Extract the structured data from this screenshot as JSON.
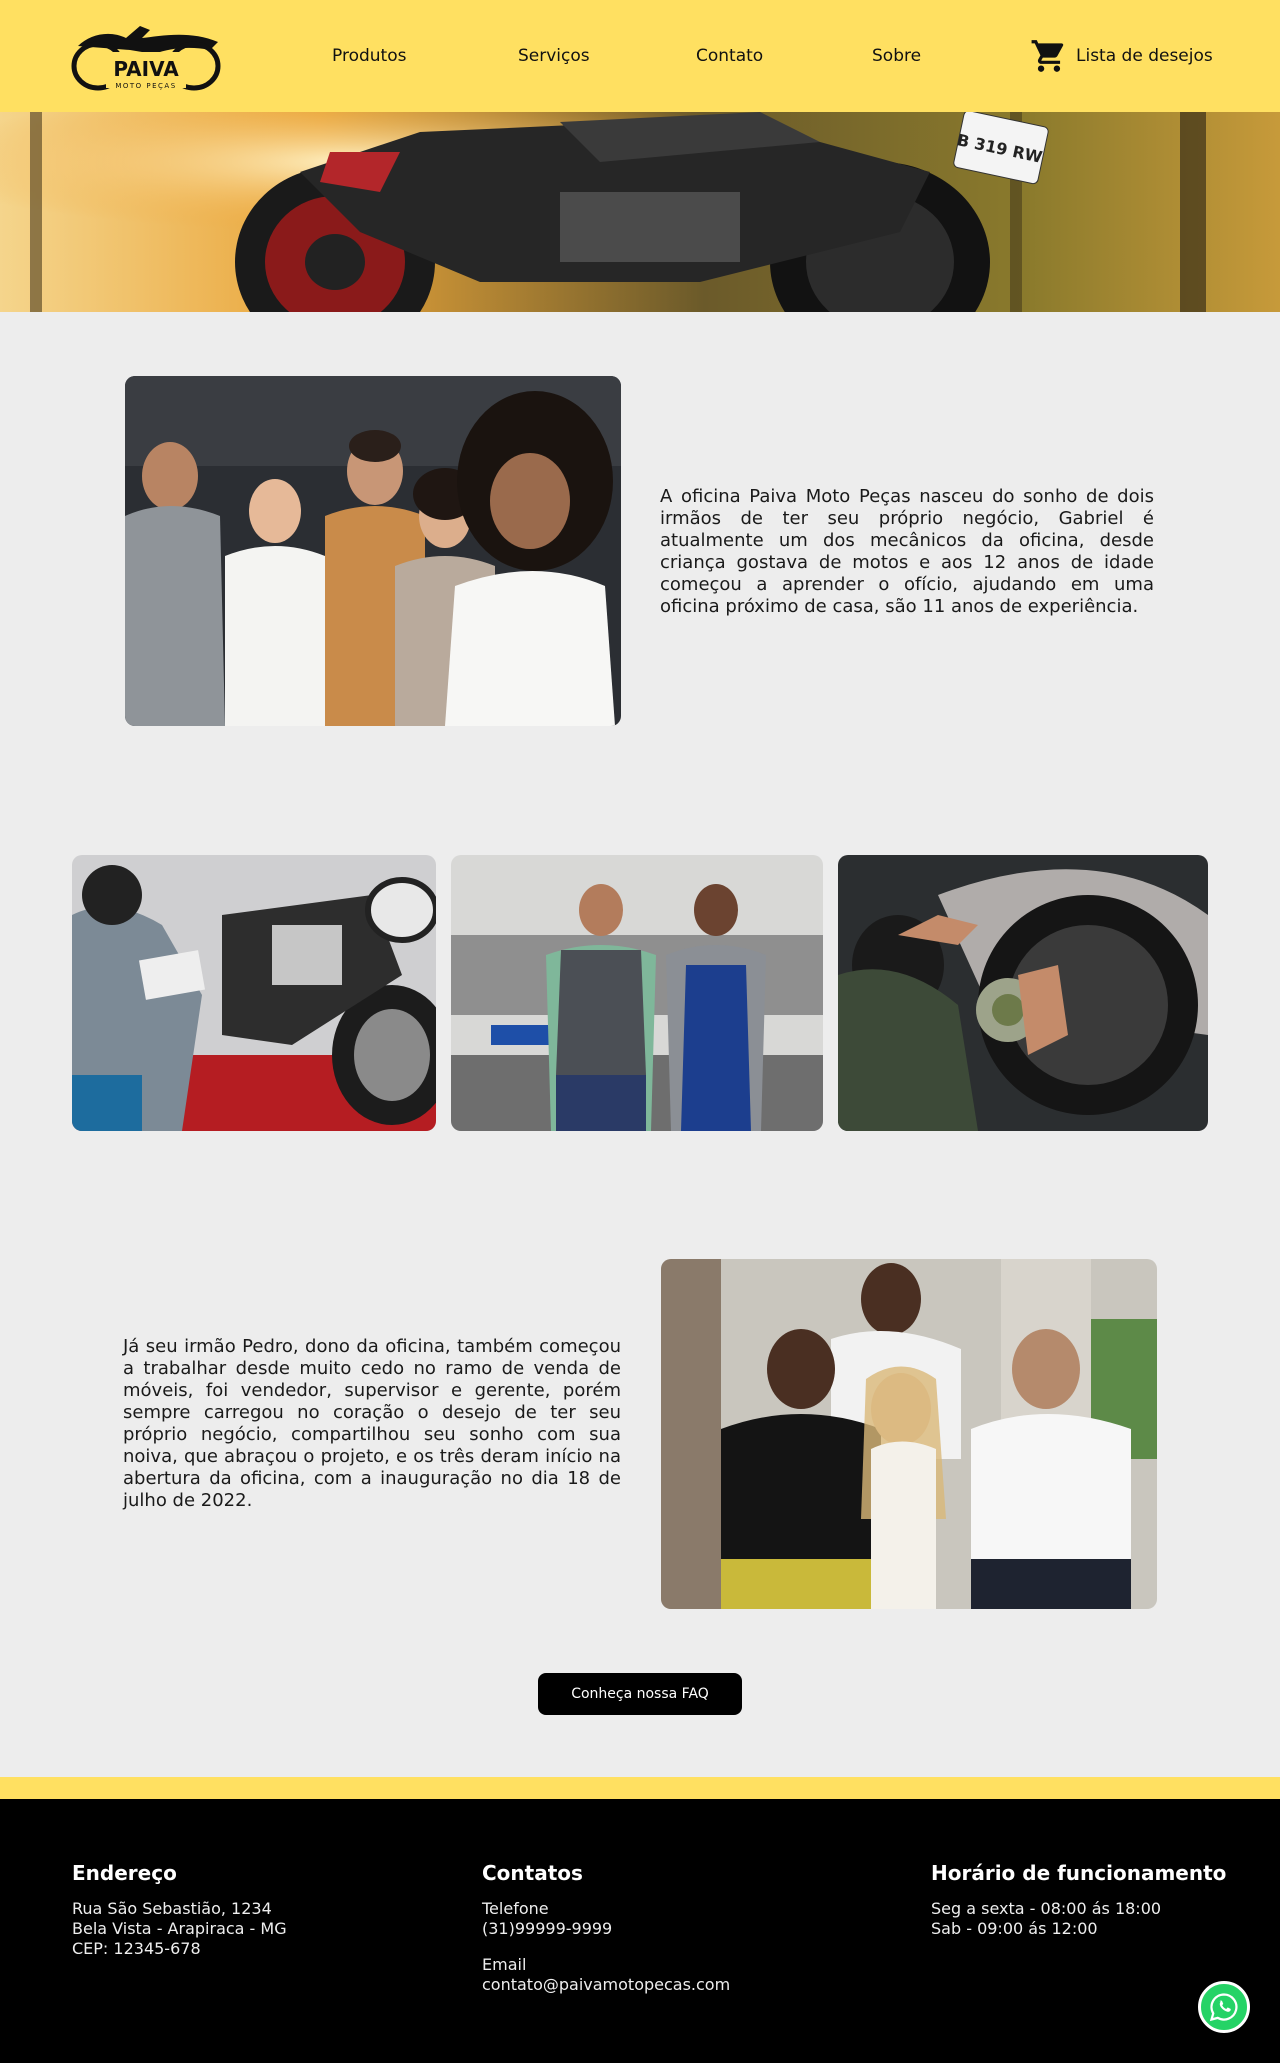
{
  "brand": {
    "name": "PAIVA",
    "tagline": "MOTO PEÇAS"
  },
  "nav": {
    "items": [
      {
        "label": "Produtos"
      },
      {
        "label": "Serviços"
      },
      {
        "label": "Contato"
      },
      {
        "label": "Sobre"
      }
    ],
    "wishlist_label": "Lista de desejos",
    "wishlist_icon": "cart-icon"
  },
  "hero": {
    "plate_text": "B 319 RW"
  },
  "about": {
    "paragraph_1": "A oficina Paiva Moto Peças nasceu do sonho de dois irmãos de ter seu próprio negócio, Gabriel é atualmente um dos mecânicos da oficina, desde criança gostava de motos e aos 12 anos de idade começou a aprender o ofício, ajudando em uma oficina próximo de casa, são 11 anos de experiência.",
    "paragraph_2": "Já seu irmão Pedro, dono da oficina, também começou a trabalhar desde muito cedo no ramo de venda de móveis, foi vendedor, supervisor e gerente, porém sempre carregou no coração o desejo de ter seu próprio negócio, compartilhou seu sonho com sua noiva, que abraçou o projeto, e os três deram início na abertura da oficina, com a inauguração no dia 18 de julho de 2022."
  },
  "faq_button": "Conheça nossa FAQ",
  "footer": {
    "address": {
      "title": "Endereço",
      "line1": "Rua São Sebastião, 1234",
      "line2": "Bela Vista - Arapiraca - MG",
      "line3": "CEP: 12345-678"
    },
    "contacts": {
      "title": "Contatos",
      "phone_label": "Telefone",
      "phone": "(31)99999-9999",
      "email_label": "Email",
      "email": "contato@paivamotopecas.com"
    },
    "hours": {
      "title": "Horário de funcionamento",
      "weekdays": "Seg a sexta - 08:00 ás 18:00",
      "saturday": "Sab - 09:00 ás 12:00"
    }
  },
  "colors": {
    "accent": "#ffe061",
    "dark": "#000000",
    "background": "#ededed",
    "whatsapp": "#25d366"
  }
}
